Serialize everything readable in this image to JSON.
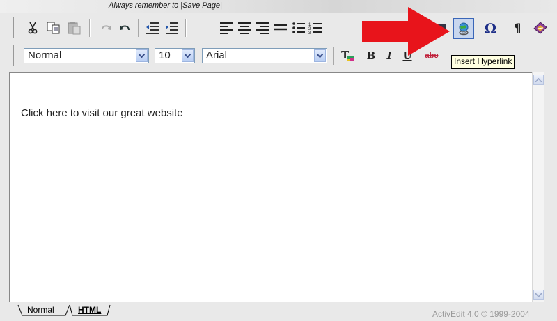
{
  "notice": {
    "text": "Always remember to |Save Page|"
  },
  "toolbar_row1": {
    "buttons": [
      {
        "name": "cut-button",
        "icon": "scissors-icon",
        "label": "Cut"
      },
      {
        "name": "copy-button",
        "icon": "copy-icon",
        "label": "Copy"
      },
      {
        "name": "paste-button",
        "icon": "paste-icon",
        "label": "Paste"
      },
      {
        "name": "redo-button",
        "icon": "redo-icon",
        "label": "Redo"
      },
      {
        "name": "undo-button",
        "icon": "undo-icon",
        "label": "Undo"
      },
      {
        "name": "outdent-button",
        "icon": "outdent-icon",
        "label": "Outdent"
      },
      {
        "name": "indent-button",
        "icon": "indent-icon",
        "label": "Indent"
      },
      {
        "name": "align-left-button",
        "icon": "align-left-icon",
        "label": "Align Left"
      },
      {
        "name": "align-center-button",
        "icon": "align-center-icon",
        "label": "Align Center"
      },
      {
        "name": "align-right-button",
        "icon": "align-right-icon",
        "label": "Align Right"
      },
      {
        "name": "justify-button",
        "icon": "justify-icon",
        "label": "Justify"
      },
      {
        "name": "bulleted-list-button",
        "icon": "bullet-list-icon",
        "label": "Bulleted List"
      },
      {
        "name": "numbered-list-button",
        "icon": "numbered-list-icon",
        "label": "Numbered List"
      },
      {
        "name": "insert-image-button",
        "icon": "image-icon",
        "label": "Insert Image"
      },
      {
        "name": "insert-hyperlink-button",
        "icon": "hyperlink-globe-icon",
        "label": "Insert Hyperlink"
      },
      {
        "name": "special-character-button",
        "icon": "omega-icon",
        "label": "Special Character"
      },
      {
        "name": "paragraph-mark-button",
        "icon": "pilcrow-icon",
        "label": "Show Paragraph Marks"
      },
      {
        "name": "spellcheck-button",
        "icon": "spellcheck-book-icon",
        "label": "Spell Check"
      }
    ]
  },
  "toolbar_row2": {
    "style_select": {
      "value": "Normal"
    },
    "size_select": {
      "value": "10"
    },
    "font_select": {
      "value": "Arial"
    },
    "bold_label": "B",
    "italic_label": "I",
    "underline_label": "U",
    "strike_label": "abc"
  },
  "tooltip": {
    "text": "Insert Hyperlink"
  },
  "editor": {
    "content": "Click here to visit our great website"
  },
  "tabs": {
    "normal": "Normal",
    "html": "HTML"
  },
  "credit": "ActivEdit 4.0 © 1999-2004",
  "colors": {
    "arrow": "#e8141b",
    "toolbar_bg": "#e9e9e9",
    "highlight_border": "#3a66b8",
    "tooltip_bg": "#ffffe1"
  }
}
